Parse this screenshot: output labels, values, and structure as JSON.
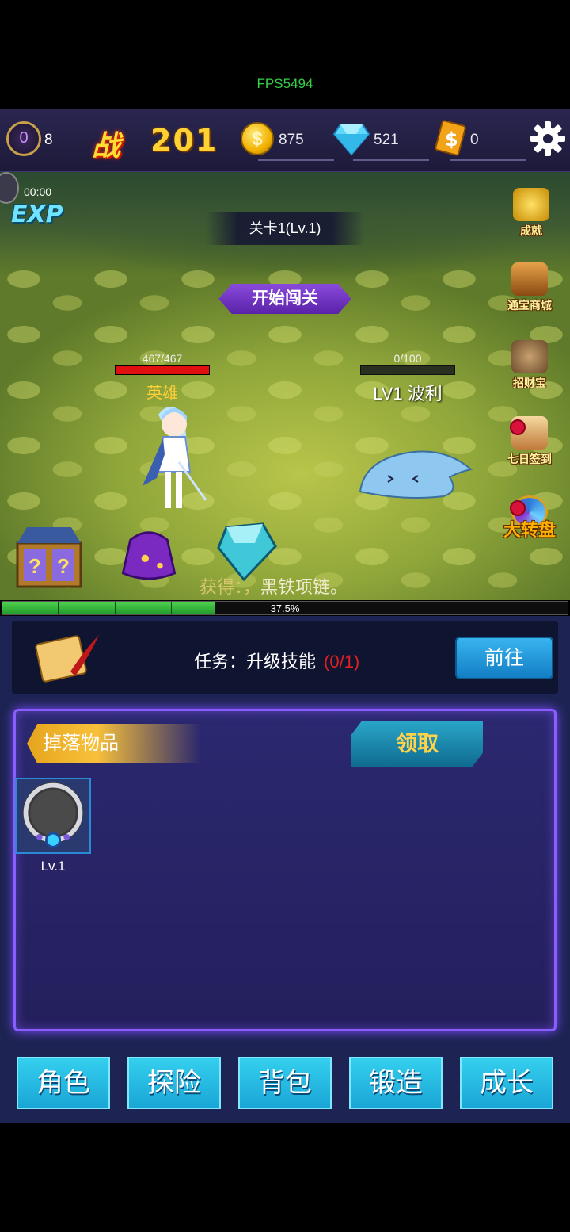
{
  "fps": "FPS5494",
  "topbar": {
    "vip_level": "0",
    "vip_count": "8",
    "power_label": "战",
    "power_value": "201",
    "gold": "875",
    "diamonds": "521",
    "cash": "0",
    "icons": [
      "vip-badge-icon",
      "coin-icon",
      "diamond-icon",
      "cash-icon",
      "gear-icon"
    ]
  },
  "scene": {
    "timer": "00:00",
    "exp_label": "EXP",
    "stage": "关卡1(Lv.1)",
    "start_button": "开始闯关",
    "hero": {
      "hp_text": "467/467",
      "hp_fraction": 1.0,
      "name": "英雄"
    },
    "enemy": {
      "hp_text": "0/100",
      "hp_fraction": 0.0,
      "name": "LV1 波利"
    },
    "side_menu": [
      {
        "label": "成就",
        "icon": "trophy-icon"
      },
      {
        "label": "通宝商城",
        "icon": "treasure-chest-icon"
      },
      {
        "label": "招财宝",
        "icon": "money-bag-icon"
      },
      {
        "label": "七日签到",
        "icon": "scroll-icon",
        "badge": true
      },
      {
        "label": "大转盘",
        "icon": "wheel-icon",
        "badge": true
      }
    ],
    "drop_prefix": "获得：，",
    "drop_item": "黑铁项链。"
  },
  "progress": {
    "text": "37.5%",
    "fraction": 0.375
  },
  "task": {
    "label": "任务：升级技能",
    "count": "(0/1)",
    "go_button": "前往"
  },
  "drops": {
    "title": "掉落物品",
    "claim_button": "领取",
    "items": [
      {
        "name": "necklace",
        "level": "Lv.1"
      }
    ]
  },
  "nav": [
    "角色",
    "探险",
    "背包",
    "锻造",
    "成长"
  ],
  "colors": {
    "accent": "#8b5cff",
    "nav_button": "#1aa6d6",
    "hp_hero": "#e01010",
    "exp_fill": "#2fb63a"
  }
}
